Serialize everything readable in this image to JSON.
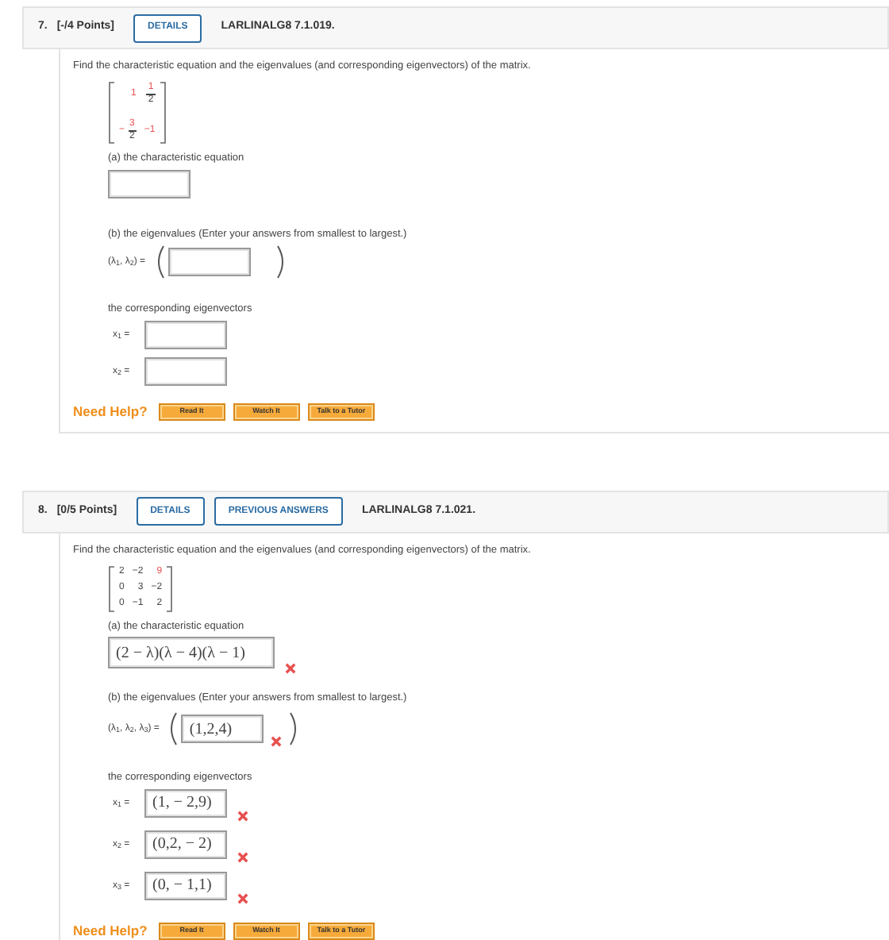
{
  "questions": [
    {
      "number": "7.",
      "points": "[-/4 Points]",
      "buttons": [
        {
          "label": "DETAILS"
        }
      ],
      "code": "LARLINALG8 7.1.019.",
      "prompt": "Find the characteristic equation and the eigenvalues (and corresponding eigenvectors) of the matrix.",
      "matrix": [
        [
          {
            "kind": "number",
            "text": "1",
            "highlight": true
          },
          {
            "kind": "fraction",
            "numerator": "1",
            "denominator": "2",
            "highlight": true
          }
        ],
        [
          {
            "kind": "fraction",
            "sign": "−",
            "numerator": "3",
            "denominator": "2",
            "highlight": true
          },
          {
            "kind": "number",
            "text": "−1",
            "highlight": true
          }
        ]
      ],
      "equation": {
        "label": "(a) the characteristic equation"
      },
      "eigenvalues": {
        "label": "(b) the eigenvalues (Enter your answers from smallest to largest.)",
        "symbol": "(λ$_{1}$, λ$_{2}$) ="
      },
      "eigenvectors": {
        "label": "the corresponding eigenvectors",
        "items": [
          {
            "symbol": "x$_{1}$ ="
          },
          {
            "symbol": "x$_{2}$ ="
          }
        ]
      },
      "help": {
        "label": "Need Help?",
        "buttons": [
          "Read It",
          "Watch It",
          "Talk to a Tutor"
        ]
      }
    },
    {
      "number": "8.",
      "points": "[0/5 Points]",
      "buttons": [
        {
          "label": "DETAILS"
        },
        {
          "label": "PREVIOUS ANSWERS"
        }
      ],
      "code": "LARLINALG8 7.1.021.",
      "prompt": "Find the characteristic equation and the eigenvalues (and corresponding eigenvectors) of the matrix.",
      "matrix": [
        [
          {
            "kind": "number",
            "text": "2",
            "highlight": false
          },
          {
            "kind": "number",
            "text": "−2",
            "highlight": false
          },
          {
            "kind": "number",
            "text": "9",
            "highlight": true
          }
        ],
        [
          {
            "kind": "number",
            "text": "0",
            "highlight": false
          },
          {
            "kind": "number",
            "text": "3",
            "highlight": false
          },
          {
            "kind": "number",
            "text": "−2",
            "highlight": false
          }
        ],
        [
          {
            "kind": "number",
            "text": "0",
            "highlight": false
          },
          {
            "kind": "number",
            "text": "−1",
            "highlight": false
          },
          {
            "kind": "number",
            "text": "2",
            "highlight": false
          }
        ]
      ],
      "equation": {
        "label": "(a) the characteristic equation",
        "value": "(2 − λ)(λ − 4)(λ − 1)",
        "marked_wrong": true
      },
      "eigenvalues": {
        "label": "(b) the eigenvalues (Enter your answers from smallest to largest.)",
        "symbol": "(λ$_{1}$, λ$_{2}$, λ$_{3}$) =",
        "value": "(1,2,4)",
        "marked_wrong": true
      },
      "eigenvectors": {
        "label": "the corresponding eigenvectors",
        "items": [
          {
            "symbol": "x$_{1}$ =",
            "value": "(1, − 2,9)",
            "marked_wrong": true
          },
          {
            "symbol": "x$_{2}$ =",
            "value": "(0,2, − 2)",
            "marked_wrong": true
          },
          {
            "symbol": "x$_{3}$ =",
            "value": "(0, − 1,1)",
            "marked_wrong": true
          }
        ]
      },
      "help": {
        "label": "Need Help?",
        "buttons": [
          "Read It",
          "Watch It",
          "Talk to a Tutor"
        ]
      }
    }
  ]
}
